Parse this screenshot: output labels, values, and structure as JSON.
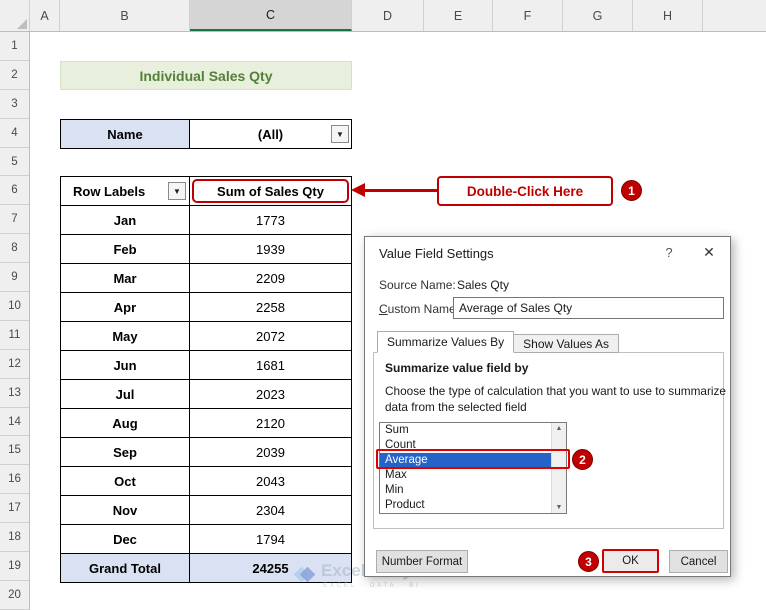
{
  "window": {
    "columns": [
      "A",
      "B",
      "C",
      "D",
      "E",
      "F",
      "G",
      "H"
    ],
    "rows": [
      "1",
      "2",
      "3",
      "4",
      "5",
      "6",
      "7",
      "8",
      "9",
      "10",
      "11",
      "12",
      "13",
      "14",
      "15",
      "16",
      "17",
      "18",
      "19",
      "20"
    ]
  },
  "sheet": {
    "title": "Individual Sales Qty",
    "filter": {
      "label": "Name",
      "value": "(All)"
    },
    "pivot": {
      "labels_header": "Row Labels",
      "values_header": "Sum of Sales Qty",
      "rows": [
        {
          "label": "Jan",
          "value": "1773"
        },
        {
          "label": "Feb",
          "value": "1939"
        },
        {
          "label": "Mar",
          "value": "2209"
        },
        {
          "label": "Apr",
          "value": "2258"
        },
        {
          "label": "May",
          "value": "2072"
        },
        {
          "label": "Jun",
          "value": "1681"
        },
        {
          "label": "Jul",
          "value": "2023"
        },
        {
          "label": "Aug",
          "value": "2120"
        },
        {
          "label": "Sep",
          "value": "2039"
        },
        {
          "label": "Oct",
          "value": "2043"
        },
        {
          "label": "Nov",
          "value": "2304"
        },
        {
          "label": "Dec",
          "value": "1794"
        }
      ],
      "total_label": "Grand Total",
      "total_value": "24255"
    }
  },
  "annotations": {
    "callout_text": "Double-Click Here",
    "step1": "1",
    "step2": "2",
    "step3": "3"
  },
  "dialog": {
    "title": "Value Field Settings",
    "source_name_label": "Source Name:",
    "source_name_value": "Sales Qty",
    "custom_name_label": "Custom Name:",
    "custom_name_value": "Average of Sales Qty",
    "tabs": [
      {
        "label": "Summarize Values By"
      },
      {
        "label": "Show Values As"
      }
    ],
    "section_title": "Summarize value field by",
    "description_line1": "Choose the type of calculation that you want to use to summarize",
    "description_line2": "data from the selected field",
    "list_items": [
      "Sum",
      "Count",
      "Average",
      "Max",
      "Min",
      "Product"
    ],
    "selected_item": "Average",
    "number_format_label": "Number Format",
    "ok_label": "OK",
    "cancel_label": "Cancel"
  },
  "watermark": {
    "brand": "ExcelDemy",
    "tagline": "EXCEL · DATA · BI"
  },
  "icons": {
    "dropdown": "▼",
    "scroll_up": "▲",
    "scroll_down": "▼",
    "help": "?",
    "close": "✕"
  },
  "colors": {
    "annotation_red": "#C00000",
    "selection_blue": "#2563C9",
    "header_fill": "#D9E1F2",
    "title_green": "#538135",
    "title_bg": "#E8EFDD",
    "excel_green": "#1E7145"
  }
}
